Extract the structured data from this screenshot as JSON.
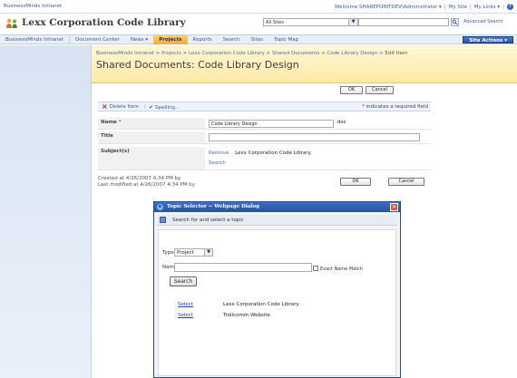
{
  "topbar": {
    "site_link": "BusinessMinds Intranet",
    "welcome": "Welcome SHAREPOINTDEV\\Administrator ▾",
    "my_site": "My Site",
    "my_links": "My Links ▾",
    "help_glyph": "?"
  },
  "header": {
    "site_title": "Lexx Corporation Code Library",
    "scope_value": "All Sites",
    "advanced_search": "Advanced Search"
  },
  "nav": {
    "items": [
      {
        "label": "BusinessMinds Intranet"
      },
      {
        "label": "Document Center"
      },
      {
        "label": "News ▾"
      },
      {
        "label": "Projects"
      },
      {
        "label": "Reports"
      },
      {
        "label": "Search"
      },
      {
        "label": "Sites"
      },
      {
        "label": "Topic Map"
      }
    ],
    "active_index": 3,
    "site_actions": "Site Actions ▾"
  },
  "title_area": {
    "breadcrumb": [
      "BusinessMinds Intranet",
      "Projects",
      "Lexx Corporation Code Library",
      "Shared Documents",
      "Code Library Design",
      "Edit Item"
    ],
    "page_title": "Shared Documents: Code Library Design"
  },
  "form": {
    "ok_label": "OK",
    "cancel_label": "Cancel",
    "delete_label": "Delete Item",
    "spelling_label": "Spelling...",
    "required_note": "indicates a required field",
    "fields": {
      "name_label": "Name",
      "name_value": "Code Library Design",
      "name_ext": ".doc",
      "title_label": "Title",
      "title_value": "",
      "subject_label": "Subject(s)",
      "remove_label": "Remove",
      "subject_value": "Lexx Corporation Code Library",
      "search_link": "Search"
    },
    "created": "Created at 4/26/2007 4:34 PM  by",
    "modified": "Last modified at 4/26/2007 4:34 PM  by"
  },
  "dialog": {
    "title": "Topic Selector -- Webpage Dialog",
    "instruction": "Search for and select a topic",
    "type_label": "Type:",
    "type_value": "Project",
    "name_label": "Name:",
    "name_value": "",
    "exact_label": "Exact Name Match",
    "search_button": "Search",
    "results": [
      {
        "select": "Select",
        "text": "Lexx Corporation Code Library"
      },
      {
        "select": "Select",
        "text": "Trollcomm Website"
      }
    ]
  },
  "colors": {
    "nav_active": "#f7a93a",
    "title_area_bg": "#ffe9a8",
    "dialog_titlebar": "#2551a3",
    "link": "#4b6fa8"
  }
}
